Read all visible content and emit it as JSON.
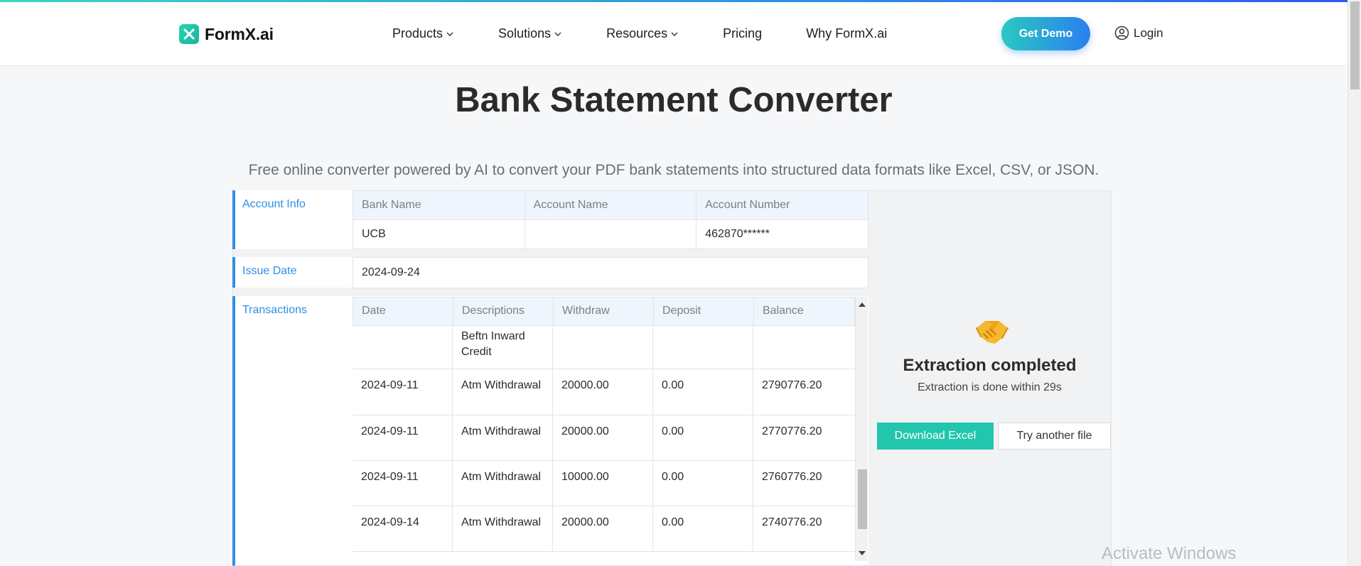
{
  "brand": {
    "name": "FormX.ai"
  },
  "nav": {
    "items": [
      {
        "label": "Products",
        "dropdown": true
      },
      {
        "label": "Solutions",
        "dropdown": true
      },
      {
        "label": "Resources",
        "dropdown": true
      },
      {
        "label": "Pricing",
        "dropdown": false
      },
      {
        "label": "Why FormX.ai",
        "dropdown": false
      }
    ],
    "cta_label": "Get Demo",
    "login_label": "Login"
  },
  "page": {
    "title": "Bank Statement Converter",
    "subtitle": "Free online converter powered by AI to convert your PDF bank statements into structured data formats like Excel, CSV, or JSON."
  },
  "account_info": {
    "label": "Account Info",
    "headers": [
      "Bank Name",
      "Account Name",
      "Account Number"
    ],
    "values": [
      "UCB",
      "",
      "462870******"
    ]
  },
  "issue_date": {
    "label": "Issue Date",
    "value": "2024-09-24"
  },
  "transactions": {
    "label": "Transactions",
    "headers": [
      "Date",
      "Descriptions",
      "Withdraw",
      "Deposit",
      "Balance"
    ],
    "partial_row": {
      "description": "Beftn Inward Credit"
    },
    "rows": [
      {
        "date": "2024-09-11",
        "description": "Atm Withdrawal",
        "withdraw": "20000.00",
        "deposit": "0.00",
        "balance": "2790776.20"
      },
      {
        "date": "2024-09-11",
        "description": "Atm Withdrawal",
        "withdraw": "20000.00",
        "deposit": "0.00",
        "balance": "2770776.20"
      },
      {
        "date": "2024-09-11",
        "description": "Atm Withdrawal",
        "withdraw": "10000.00",
        "deposit": "0.00",
        "balance": "2760776.20"
      },
      {
        "date": "2024-09-14",
        "description": "Atm Withdrawal",
        "withdraw": "20000.00",
        "deposit": "0.00",
        "balance": "2740776.20"
      }
    ]
  },
  "result": {
    "icon": "handshake-icon",
    "title": "Extraction completed",
    "subtitle": "Extraction is done within 29s",
    "download_label": "Download Excel",
    "try_label": "Try another file"
  },
  "os_watermark": "Activate Windows",
  "colors": {
    "accent_blue": "#2f8ee8",
    "accent_teal": "#22c6ac",
    "header_bg": "#eef5fd"
  }
}
